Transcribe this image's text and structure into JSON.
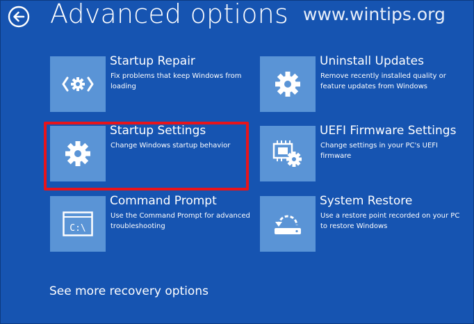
{
  "page": {
    "title": "Advanced options",
    "watermark": "www.wintips.org"
  },
  "options": [
    {
      "title": "Startup Repair",
      "description": "Fix problems that keep Windows from loading",
      "icon": "startup-repair-icon"
    },
    {
      "title": "Uninstall Updates",
      "description": "Remove recently installed quality or feature updates from Windows",
      "icon": "gear-icon"
    },
    {
      "title": "Startup Settings",
      "description": "Change Windows startup behavior",
      "icon": "gear-icon",
      "highlighted": true
    },
    {
      "title": "UEFI Firmware Settings",
      "description": "Change settings in your PC's UEFI firmware",
      "icon": "firmware-chip-icon"
    },
    {
      "title": "Command Prompt",
      "description": "Use the Command Prompt for advanced troubleshooting",
      "icon": "command-prompt-icon",
      "icon_text": "C:\\"
    },
    {
      "title": "System Restore",
      "description": "Use a restore point recorded on your PC to restore Windows",
      "icon": "system-restore-icon"
    }
  ],
  "footer": {
    "more_options": "See more recovery options"
  },
  "colors": {
    "background": "#1654b1",
    "tile": "#5a94d6",
    "highlight": "#e8141b"
  }
}
